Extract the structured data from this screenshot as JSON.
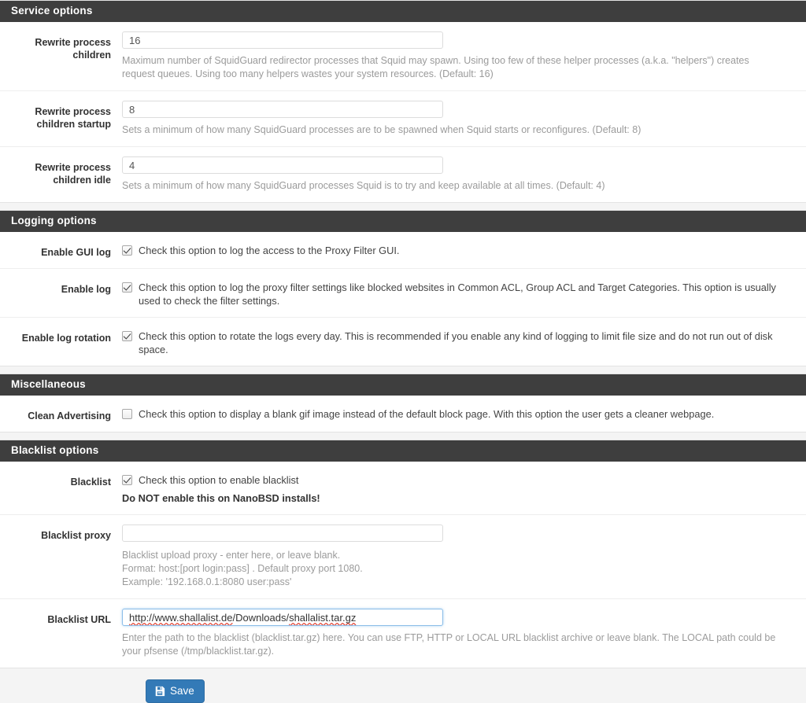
{
  "sections": [
    {
      "id": "service-options",
      "title": "Service options",
      "rows": [
        {
          "label": "Rewrite process children",
          "type": "text",
          "value": "16",
          "help": "Maximum number of SquidGuard redirector processes that Squid may spawn. Using too few of these helper processes (a.k.a. \"helpers\") creates request queues. Using too many helpers wastes your system resources. (Default: 16)"
        },
        {
          "label": "Rewrite process children startup",
          "type": "text",
          "value": "8",
          "help": "Sets a minimum of how many SquidGuard processes are to be spawned when Squid starts or reconfigures. (Default: 8)"
        },
        {
          "label": "Rewrite process children idle",
          "type": "text",
          "value": "4",
          "help": "Sets a minimum of how many SquidGuard processes Squid is to try and keep available at all times. (Default: 4)"
        }
      ]
    },
    {
      "id": "logging-options",
      "title": "Logging options",
      "rows": [
        {
          "label": "Enable GUI log",
          "type": "checkbox",
          "checked": true,
          "check_label": "Check this option to log the access to the Proxy Filter GUI."
        },
        {
          "label": "Enable log",
          "type": "checkbox",
          "checked": true,
          "check_label": "Check this option to log the proxy filter settings like blocked websites in Common ACL, Group ACL and Target Categories. This option is usually used to check the filter settings."
        },
        {
          "label": "Enable log rotation",
          "type": "checkbox",
          "checked": true,
          "check_label": "Check this option to rotate the logs every day. This is recommended if you enable any kind of logging to limit file size and do not run out of disk space."
        }
      ]
    },
    {
      "id": "miscellaneous",
      "title": "Miscellaneous",
      "rows": [
        {
          "label": "Clean Advertising",
          "type": "checkbox",
          "checked": false,
          "check_label": "Check this option to display a blank gif image instead of the default block page. With this option the user gets a cleaner webpage."
        }
      ]
    },
    {
      "id": "blacklist-options",
      "title": "Blacklist options",
      "rows": [
        {
          "label": "Blacklist",
          "type": "checkbox",
          "checked": true,
          "check_label": "Check this option to enable blacklist",
          "warning": "Do NOT enable this on NanoBSD installs!"
        },
        {
          "label": "Blacklist proxy",
          "type": "text",
          "value": "",
          "placeholder": "",
          "help_lines": [
            "Blacklist upload proxy - enter here, or leave blank.",
            "Format: host:[port login:pass] . Default proxy port 1080.",
            "Example: '192.168.0.1:8080 user:pass'"
          ]
        },
        {
          "label": "Blacklist URL",
          "type": "url",
          "value": "http://www.shallalist.de/Downloads/shallalist.tar.gz",
          "url_parts": {
            "misspelled_1": "http://www.shallalist.de",
            "plain_1": "/Downloads/",
            "misspelled_2": "shallalist.tar.gz"
          },
          "focused": true,
          "help": "Enter the path to the blacklist (blacklist.tar.gz) here. You can use FTP, HTTP or LOCAL URL blacklist archive or leave blank. The LOCAL path could be your pfsense (/tmp/blacklist.tar.gz)."
        }
      ]
    }
  ],
  "footer": {
    "save_label": "Save",
    "save_icon": "floppy-disk-icon"
  },
  "colors": {
    "panel_heading_bg": "#3e3e3e",
    "panel_heading_text": "#ffffff",
    "page_bg": "#f4f4f4",
    "primary_button": "#337ab7",
    "help_text": "#9b9b9b",
    "focus_border": "#8bbde8",
    "spellcheck_underline": "#e24a3b"
  }
}
